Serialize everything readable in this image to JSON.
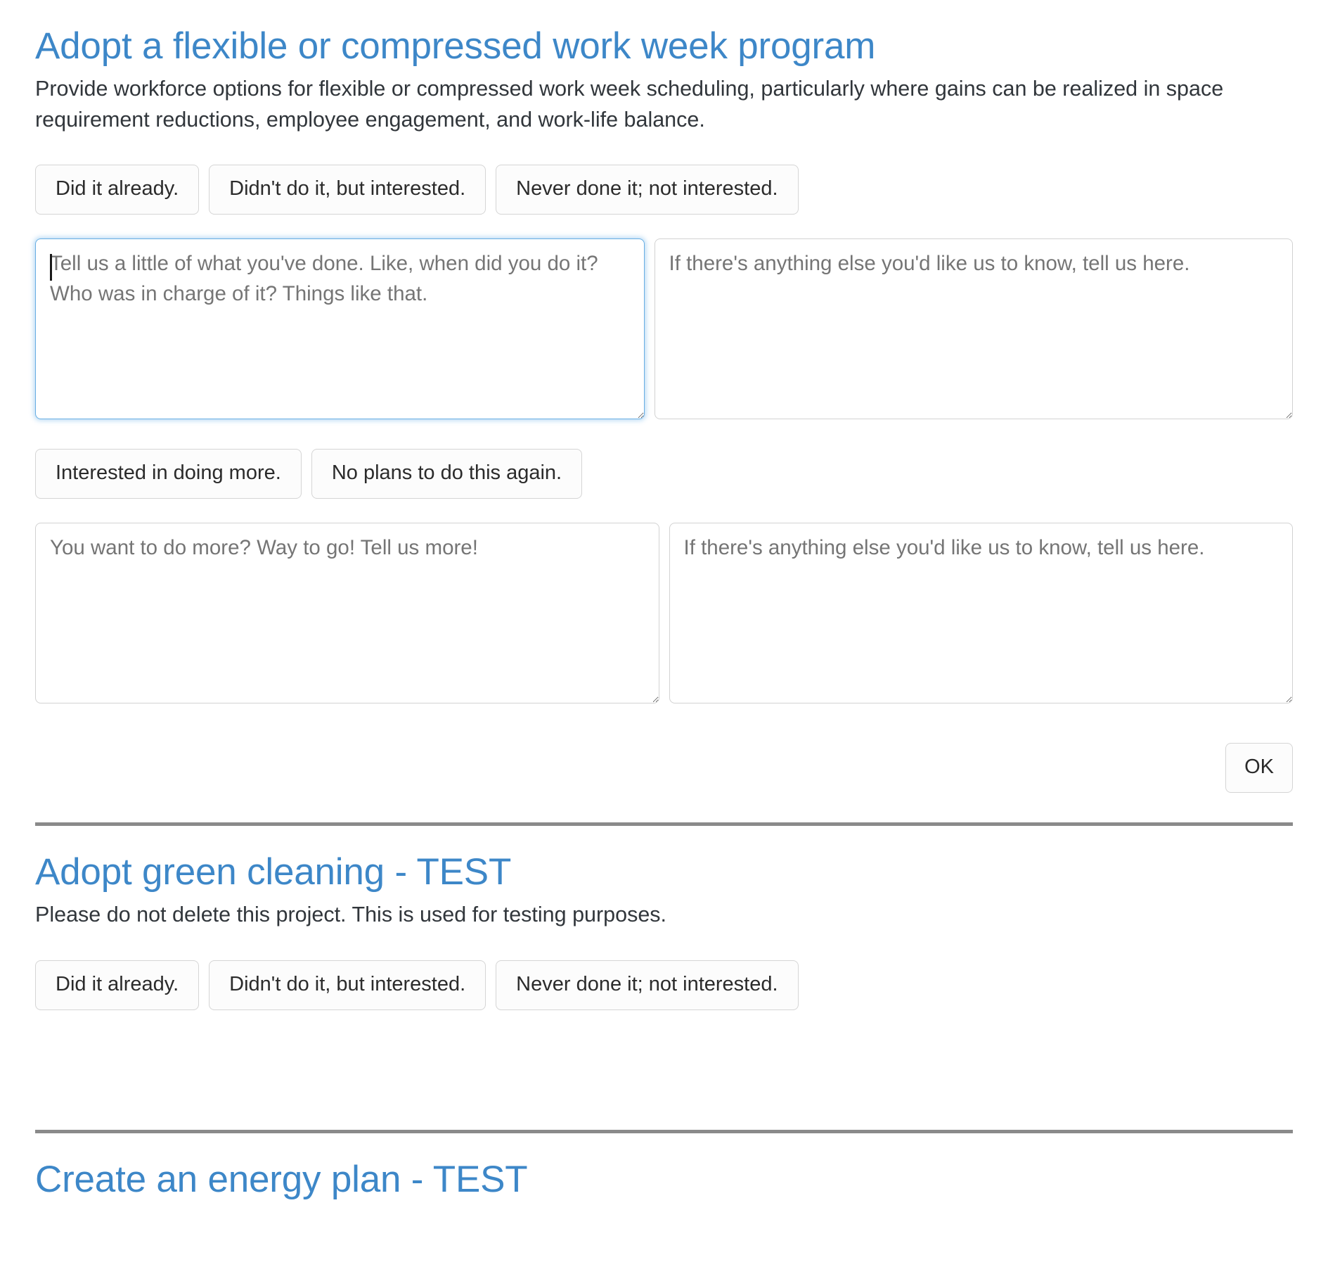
{
  "projects": [
    {
      "title": "Adopt a flexible or compressed work week program",
      "description": "Provide workforce options for flexible or compressed work week scheduling, particularly where gains can be realized in space requirement reductions, employee engagement, and work-life balance.",
      "status_buttons": [
        "Did it already.",
        "Didn't do it, but interested.",
        "Never done it; not interested."
      ],
      "detail_textareas": [
        {
          "placeholder": "Tell us a little of what you've done. Like, when did you do it? Who was in charge of it? Things like that.",
          "value": "",
          "focused": true
        },
        {
          "placeholder": "If there's anything else you'd like us to know, tell us here.",
          "value": "",
          "focused": false
        }
      ],
      "followup_buttons": [
        "Interested in doing more.",
        "No plans to do this again."
      ],
      "followup_textareas": [
        {
          "placeholder": "You want to do more? Way to go! Tell us more!",
          "value": "",
          "focused": false
        },
        {
          "placeholder": "If there's anything else you'd like us to know, tell us here.",
          "value": "",
          "focused": false
        }
      ],
      "submit_label": "OK"
    },
    {
      "title": "Adopt green cleaning - TEST",
      "description": "Please do not delete this project. This is used for testing purposes.",
      "status_buttons": [
        "Did it already.",
        "Didn't do it, but interested.",
        "Never done it; not interested."
      ]
    },
    {
      "title": "Create an energy plan - TEST"
    }
  ],
  "colors": {
    "heading": "#3d87c8",
    "body_text": "#31363b",
    "placeholder": "#757575",
    "button_border": "#d5d5d5",
    "focus_border": "#68aee3",
    "divider": "#8a8a8a"
  }
}
